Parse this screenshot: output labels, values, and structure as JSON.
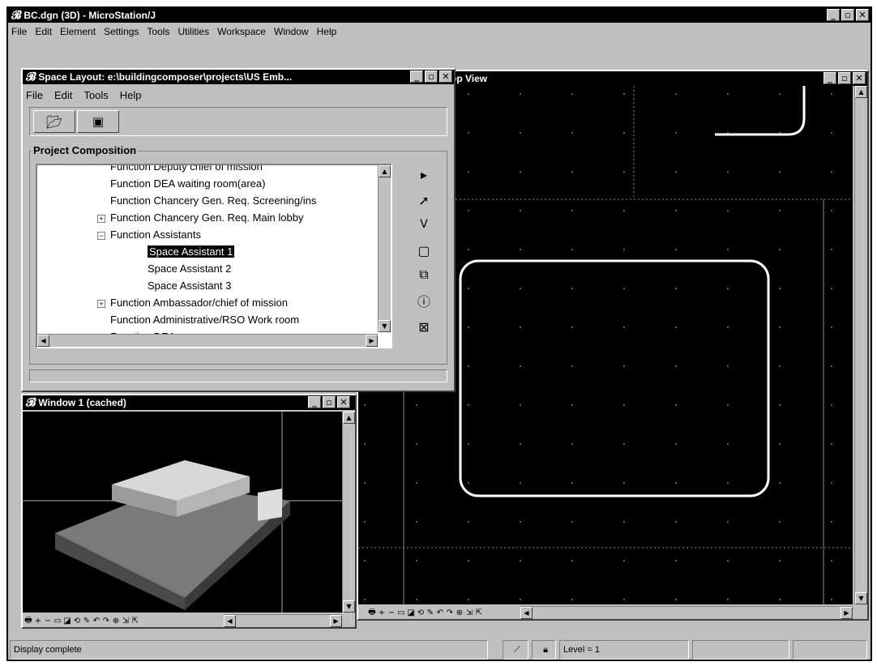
{
  "app": {
    "title": "BC.dgn (3D) - MicroStation/J",
    "logo": "𝓑",
    "menu": [
      "File",
      "Edit",
      "Element",
      "Settings",
      "Tools",
      "Utilities",
      "Workspace",
      "Window",
      "Help"
    ],
    "window_buttons": [
      "_",
      "▫",
      "✕"
    ]
  },
  "space_layout": {
    "title": "Space Layout: e:\\buildingcomposer\\projects\\US Emb...",
    "menu": [
      "File",
      "Edit",
      "Tools",
      "Help"
    ],
    "toolbar_icons": [
      "open-folder-icon",
      "save-icon"
    ],
    "group_label": "Project Composition",
    "tree": [
      {
        "label": "Function Deputy chief of mission",
        "indent": 0,
        "expander": ""
      },
      {
        "label": "Function DEA waiting room(area)",
        "indent": 0,
        "expander": ""
      },
      {
        "label": "Function Chancery Gen. Req. Screening/ins",
        "indent": 0,
        "expander": ""
      },
      {
        "label": "Function Chancery Gen. Req. Main lobby",
        "indent": 0,
        "expander": "+"
      },
      {
        "label": "Function Assistants",
        "indent": 0,
        "expander": "−"
      },
      {
        "label": "Space Assistant 1",
        "indent": 1,
        "expander": "",
        "selected": true
      },
      {
        "label": "Space Assistant 2",
        "indent": 1,
        "expander": ""
      },
      {
        "label": "Space Assistant 3",
        "indent": 1,
        "expander": ""
      },
      {
        "label": "Function Ambassador/chief of mission",
        "indent": 0,
        "expander": "+"
      },
      {
        "label": "Function Administrative/RSO Work room",
        "indent": 0,
        "expander": ""
      },
      {
        "label": "Function DEA ...",
        "indent": 0,
        "expander": ""
      }
    ],
    "side_tools": [
      "expand-arrow-icon",
      "select-arrow-icon",
      "check-icon",
      "rectangle-icon",
      "place-space-icon",
      "info-icon",
      "delete-icon"
    ]
  },
  "window1": {
    "title": "Window 1 (cached)"
  },
  "top_view": {
    "title": "op View"
  },
  "view_controls": [
    "🖶",
    "+",
    "−",
    "▭",
    "◪",
    "⟲",
    "✎",
    "↶",
    "↷",
    "⊕",
    "⇲",
    "⇱"
  ],
  "status": {
    "message": "Display complete",
    "level": "Level = 1"
  },
  "colors": {
    "titlebar": "#000000",
    "canvas": "#000000",
    "space_outline": "#ffffff",
    "selection": "#000000"
  }
}
